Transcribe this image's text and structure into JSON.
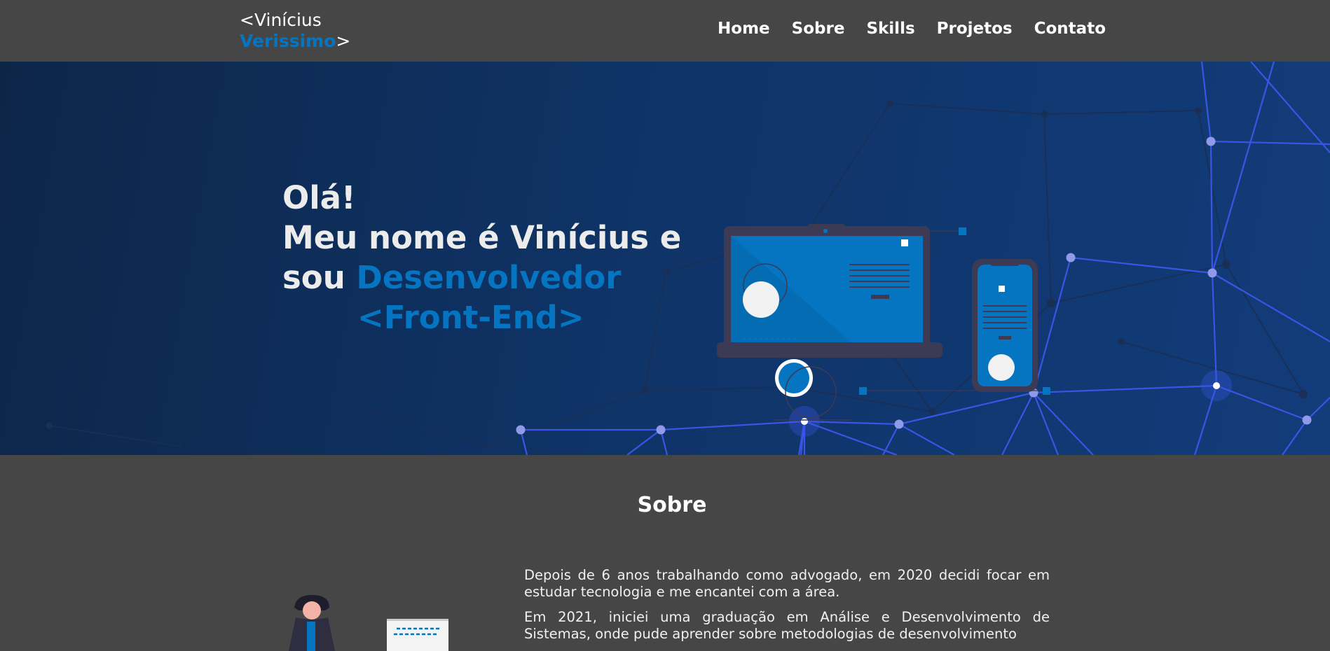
{
  "header": {
    "logo_prefix": "<Vinícius",
    "logo_accent": "Verissimo",
    "logo_suffix": ">",
    "nav": [
      {
        "label": "Home"
      },
      {
        "label": "Sobre"
      },
      {
        "label": "Skills"
      },
      {
        "label": "Projetos"
      },
      {
        "label": "Contato"
      }
    ]
  },
  "hero": {
    "line1": "Olá!",
    "line2": "Meu nome é Vinícius e",
    "line3_prefix": "sou ",
    "line3_accent": "Desenvolvedor",
    "line4": "<Front-End>"
  },
  "about": {
    "title": "Sobre",
    "paragraphs": [
      "Depois de 6 anos trabalhando como advogado, em 2020 decidi focar em estudar tecnologia e me encantei com a área.",
      "Em 2021, iniciei uma graduação em Análise e Desenvolvimento de Sistemas, onde pude aprender sobre metodologias de desenvolvimento"
    ]
  },
  "colors": {
    "accent": "#0575c2",
    "background": "#464646",
    "hero_dark": "#0d2648",
    "hero_light": "#123c7a",
    "network_line": "#3a55e6"
  }
}
